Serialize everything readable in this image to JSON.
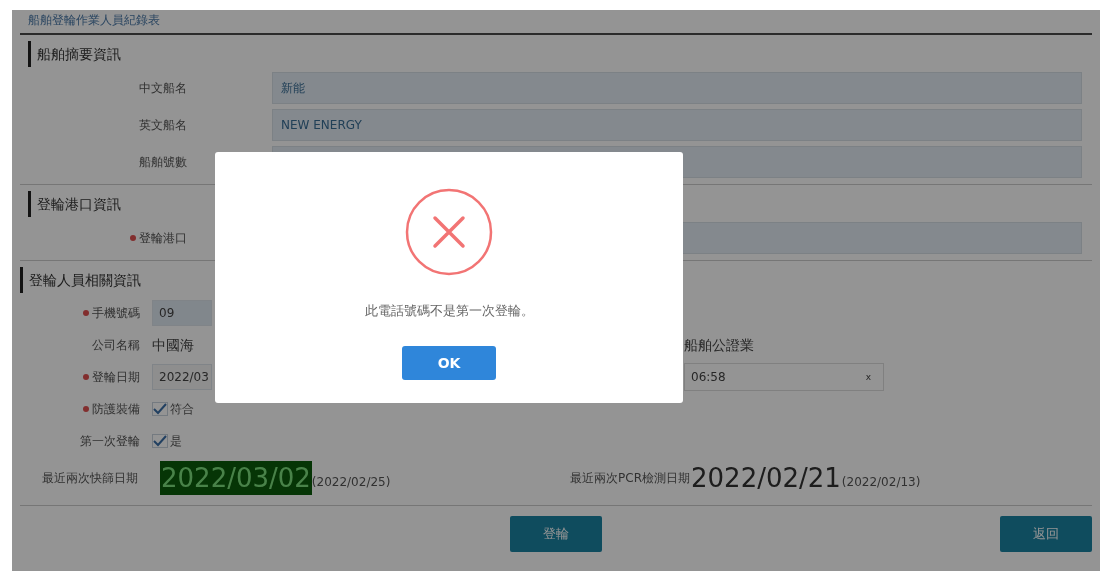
{
  "header": {
    "title": "船舶登輪作業人員紀錄表"
  },
  "sections": [
    {
      "title": "船舶摘要資訊",
      "rows": [
        {
          "label": "中文船名",
          "required": false,
          "value": "新能"
        },
        {
          "label": "英文船名",
          "required": false,
          "value": "NEW ENERGY"
        },
        {
          "label": "船舶號數",
          "required": false
        }
      ]
    },
    {
      "title": "登輪港口資訊",
      "rows": [
        {
          "label": "登輪港口",
          "required": true
        }
      ]
    }
  ],
  "crew": {
    "title": "登輪人員相關資訊",
    "rows": [
      {
        "kind": "field",
        "label": "手機號碼",
        "required": true,
        "value": "09"
      },
      {
        "kind": "text",
        "label": "公司名稱",
        "required": false,
        "value": "中國海",
        "extra": {
          "kind": "text",
          "value": "船舶公證業"
        }
      },
      {
        "kind": "date",
        "label": "登輪日期",
        "required": true,
        "value": "2022/03",
        "extra": {
          "kind": "select",
          "value": "06:58",
          "clear": "x"
        }
      },
      {
        "kind": "checkbox",
        "label": "防護裝備",
        "required": true,
        "checked": true,
        "option": "符合"
      },
      {
        "kind": "checkbox",
        "label": "第一次登輪",
        "required": false,
        "checked": true,
        "option": "是"
      }
    ]
  },
  "tests": [
    {
      "label": "最近兩次快篩日期",
      "latest": "2022/03/02",
      "previous": "(2022/02/25)",
      "highlight": true
    },
    {
      "label": "最近兩次PCR檢測日期",
      "latest": "2022/02/21",
      "previous": "(2022/02/13)",
      "highlight": false
    }
  ],
  "buttons": [
    {
      "label": "登輪"
    },
    {
      "label": "返回"
    }
  ],
  "dialog": {
    "kind": "error",
    "message": "此電話號碼不是第一次登輪。",
    "button": "OK"
  }
}
